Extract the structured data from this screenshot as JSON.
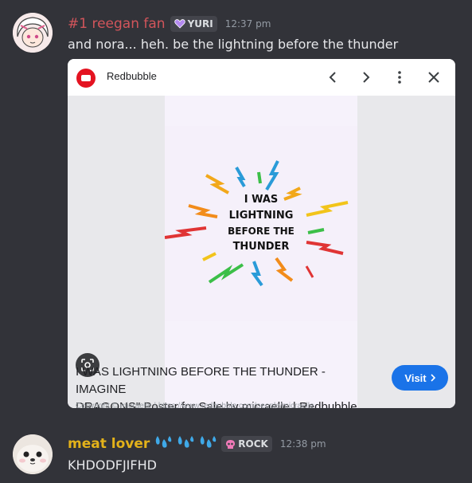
{
  "messages": [
    {
      "username": "#1 reegan fan",
      "username_color": "#d2555b",
      "role_tag": "YURI",
      "role_icon": "purple-heart-icon",
      "timestamp": "12:37 pm",
      "content": "and nora... heh. be the lightning before the thunder"
    },
    {
      "username": "meat lover",
      "username_color": "#e3b21a",
      "username_icons": [
        "sweat-droplets-icon",
        "sweat-droplets-icon",
        "sweat-droplets-icon"
      ],
      "role_tag": "ROCK",
      "role_icon": "pink-skull-icon",
      "timestamp": "12:38 pm",
      "content": "KHDODFJIFHD"
    }
  ],
  "embed": {
    "site_name": "Redbubble",
    "poster_text": [
      "I WAS",
      "LIGHTNING",
      "BEFORE THE",
      "THUNDER"
    ],
    "caption_line1": "I WAS LIGHTNING BEFORE THE THUNDER - IMAGINE",
    "caption_line2": "DRAGONS\" Poster for Sale by micraelle | Redbubble",
    "visit_label": "Visit",
    "copyright": "Copyright © micraelle | https://www.redbubble.com/people/micraelle"
  },
  "colors": {
    "background": "#323339",
    "visit_button": "#1a73e8",
    "redbubble_logo": "#e41321"
  }
}
